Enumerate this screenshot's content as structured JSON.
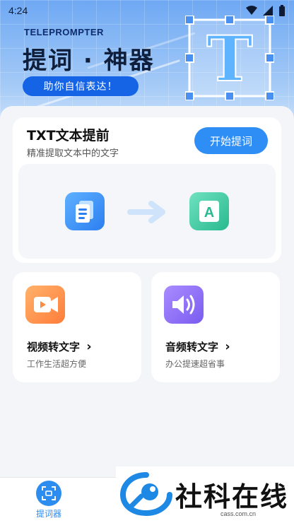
{
  "status": {
    "time": "4:24"
  },
  "header": {
    "brand_en": "TELEPROMPTER",
    "brand_cn": "提词 · 神器",
    "slogan": "助你自信表达！",
    "logo_letter": "T"
  },
  "txt_card": {
    "title": "TXT文本提前",
    "subtitle": "精准提取文本中的文字",
    "button_label": "开始提词",
    "result_letter": "A"
  },
  "features": [
    {
      "title": "视频转文字",
      "chevron": "›",
      "subtitle": "工作生活超方便"
    },
    {
      "title": "音频转文字",
      "chevron": "›",
      "subtitle": "办公提速超省事"
    }
  ],
  "nav": {
    "items": [
      {
        "label": "提词器"
      }
    ]
  },
  "watermark": {
    "text": "社科在线",
    "url": "cass.com.cn"
  },
  "colors": {
    "primary": "#2f8ef5",
    "header_top": "#6ea8f3",
    "video_orange": "#ff8a3d",
    "audio_purple": "#8b6cf2"
  }
}
